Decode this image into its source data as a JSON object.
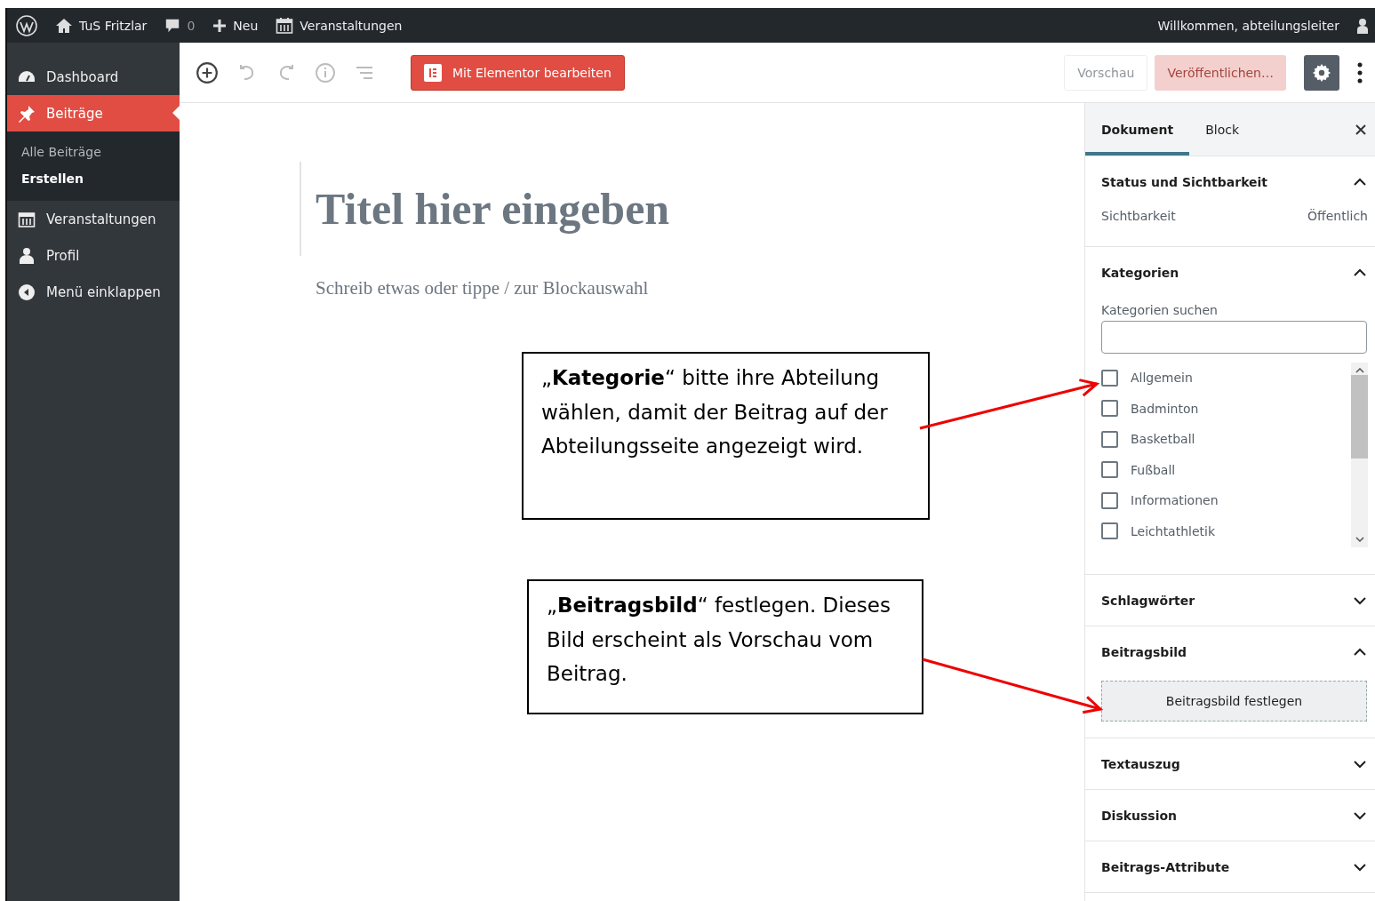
{
  "admin_bar": {
    "site": "TuS Fritzlar",
    "comments": "0",
    "new": "Neu",
    "events": "Veranstaltungen",
    "greeting": "Willkommen, abteilungsleiter"
  },
  "menu": {
    "items": [
      {
        "label": "Dashboard",
        "selected": false
      },
      {
        "label": "Beiträge",
        "selected": true,
        "children": [
          {
            "label": "Alle Beiträge",
            "selected": false
          },
          {
            "label": "Erstellen",
            "selected": true
          }
        ]
      },
      {
        "label": "Veranstaltungen",
        "selected": false
      },
      {
        "label": "Profil",
        "selected": false
      },
      {
        "label": "Menü einklappen",
        "selected": false
      }
    ]
  },
  "toolbar": {
    "elementor": "Mit Elementor bearbeiten",
    "preview": {
      "label": "Vorschau",
      "disabled": true
    },
    "publish": {
      "label": "Veröffentlichen…",
      "disabled": true
    },
    "settings_on": true
  },
  "editor": {
    "title_placeholder": "Titel hier eingeben",
    "body_placeholder": "Schreib etwas oder tippe / zur Blockauswahl"
  },
  "sidebar": {
    "tabs": [
      {
        "label": "Dokument",
        "selected": true
      },
      {
        "label": "Block",
        "selected": false
      }
    ],
    "panels": [
      {
        "kind": "rows",
        "title": "Status und Sichtbarkeit",
        "expanded": true,
        "rows": [
          {
            "label": "Sichtbarkeit",
            "value": "Öffentlich"
          }
        ]
      },
      {
        "kind": "categories",
        "title": "Kategorien",
        "expanded": true,
        "search": {
          "label": "Kategorien suchen"
        },
        "items": [
          {
            "label": "Allgemein",
            "checked": false
          },
          {
            "label": "Badminton",
            "checked": false
          },
          {
            "label": "Basketball",
            "checked": false
          },
          {
            "label": "Fußball",
            "checked": false
          },
          {
            "label": "Informationen",
            "checked": false
          },
          {
            "label": "Leichtathletik",
            "checked": false
          }
        ]
      },
      {
        "title": "Schlagwörter",
        "expanded": false
      },
      {
        "kind": "image",
        "title": "Beitragsbild",
        "expanded": true,
        "button": "Beitragsbild festlegen"
      },
      {
        "title": "Textauszug",
        "expanded": false
      },
      {
        "title": "Diskussion",
        "expanded": false
      },
      {
        "title": "Beitrags-Attribute",
        "expanded": false
      }
    ]
  },
  "callouts": [
    {
      "text": "„**Kategorie**“ bitte ihre Abteilung wählen, damit der Beitrag auf der Abteilungsseite angezeigt wird."
    },
    {
      "text": "„**Beitragsbild**“ festlegen. Dieses Bild erscheint als Vorschau vom Beitrag."
    }
  ]
}
